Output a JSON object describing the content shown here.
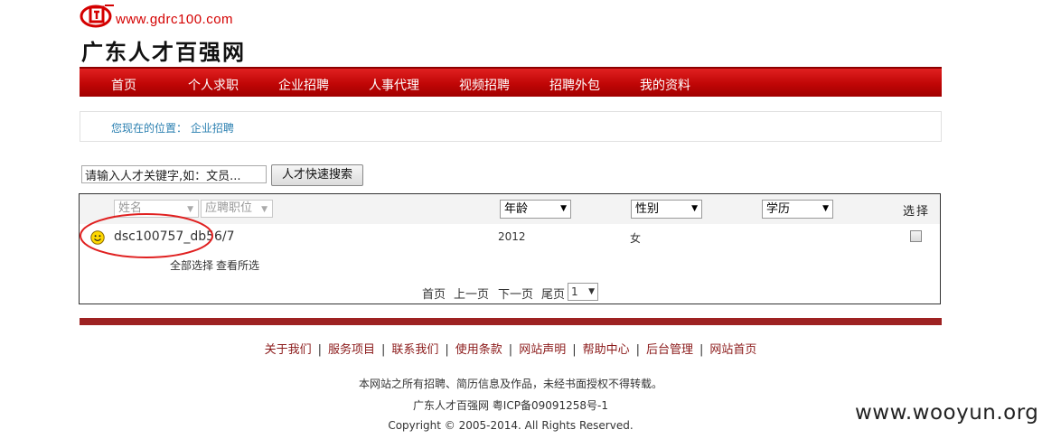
{
  "header": {
    "logo_url": "www.gdrc100.com",
    "site_name": "广东人才百强网"
  },
  "nav": {
    "items": [
      "首页",
      "个人求职",
      "企业招聘",
      "人事代理",
      "视频招聘",
      "招聘外包",
      "我的资料"
    ]
  },
  "breadcrumb": {
    "text": "您现在的位置： 企业招聘"
  },
  "search": {
    "value": "请输入人才关键字,如：文员...",
    "button_label": "人才快速搜索"
  },
  "table": {
    "filters": {
      "name_placeholder": "姓名",
      "position_placeholder": "应聘职位",
      "age_label": "年龄",
      "gender_label": "性别",
      "education_label": "学历",
      "select_header": "选择"
    },
    "row": {
      "name": "dsc100757_db5",
      "name_suffix": "6/7",
      "age": "2012",
      "gender": "女"
    },
    "actions": {
      "select_all": "全部选择",
      "view_selected": "查看所选"
    },
    "pager": {
      "first": "首页",
      "prev": "上一页",
      "next": "下一页",
      "last": "尾页",
      "page_value": "1"
    }
  },
  "footer": {
    "links": [
      "关于我们",
      "服务项目",
      "联系我们",
      "使用条款",
      "网站声明",
      "帮助中心",
      "后台管理",
      "网站首页"
    ],
    "notice": "本网站之所有招聘、简历信息及作品，未经书面授权不得转载。",
    "icp": "广东人才百强网  粤ICP备09091258号-1",
    "copyright": "Copyright © 2005-2014. All Rights Reserved."
  },
  "watermark": "www.wooyun.org",
  "colors": {
    "nav_red": "#c00606",
    "footer_bar": "#9e2222",
    "link_red": "#8b1a1a",
    "breadcrumb_blue": "#2a7fb0",
    "annotation_red": "#e02020"
  }
}
